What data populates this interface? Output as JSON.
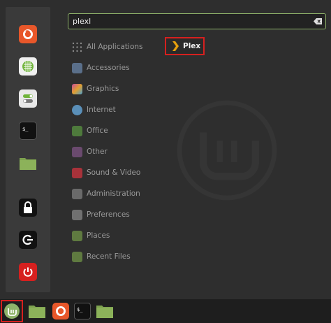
{
  "search": {
    "value": "plexl"
  },
  "categories": [
    {
      "label": "All Applications",
      "icon": "grid-icon"
    },
    {
      "label": "Accessories",
      "icon": "accessories-icon"
    },
    {
      "label": "Graphics",
      "icon": "graphics-icon"
    },
    {
      "label": "Internet",
      "icon": "internet-icon"
    },
    {
      "label": "Office",
      "icon": "office-icon"
    },
    {
      "label": "Other",
      "icon": "other-icon"
    },
    {
      "label": "Sound & Video",
      "icon": "sound-video-icon"
    },
    {
      "label": "Administration",
      "icon": "administration-icon"
    },
    {
      "label": "Preferences",
      "icon": "preferences-icon"
    },
    {
      "label": "Places",
      "icon": "folder-icon"
    },
    {
      "label": "Recent Files",
      "icon": "folder-icon"
    }
  ],
  "results": [
    {
      "label": "Plex",
      "icon": "plex-icon"
    }
  ],
  "favorites": [
    {
      "icon": "firefox-icon"
    },
    {
      "icon": "software-manager-icon"
    },
    {
      "icon": "settings-toggle-icon"
    },
    {
      "icon": "terminal-icon"
    },
    {
      "icon": "folder-icon"
    },
    {
      "icon": "lock-icon"
    },
    {
      "icon": "logout-icon"
    },
    {
      "icon": "power-icon"
    }
  ],
  "taskbar": [
    {
      "icon": "mint-menu-icon"
    },
    {
      "icon": "folder-icon"
    },
    {
      "icon": "firefox-icon"
    },
    {
      "icon": "terminal-icon"
    },
    {
      "icon": "folder-icon"
    }
  ],
  "colors": {
    "accent": "#8fb36a",
    "highlight": "#d6201f",
    "folder": "#7ea24f",
    "plex": "#e5a00d"
  }
}
